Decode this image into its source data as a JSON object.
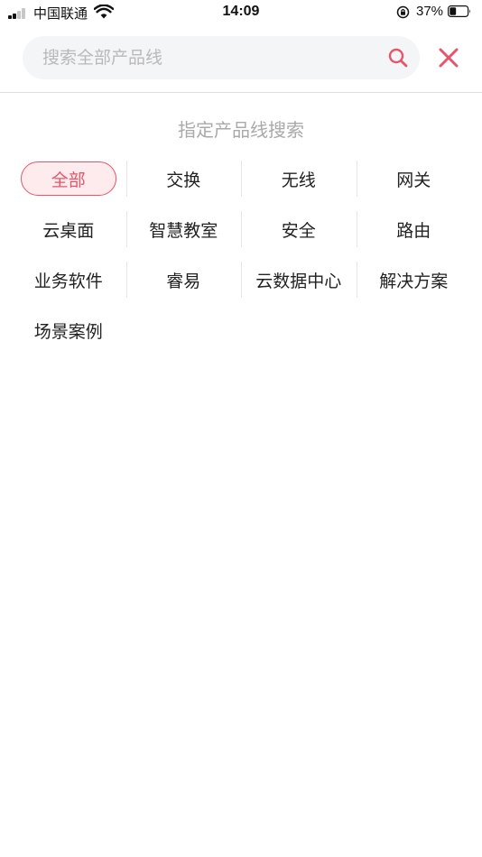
{
  "status_bar": {
    "carrier": "中国联通",
    "time": "14:09",
    "battery_percent": "37%",
    "battery_level": 0.37,
    "icons": [
      "signal-icon",
      "wifi-icon",
      "rotation-lock-icon",
      "battery-icon"
    ]
  },
  "search": {
    "value": "",
    "placeholder": "搜索全部产品线",
    "search_icon": "search-icon",
    "close_icon": "close-icon"
  },
  "section": {
    "title": "指定产品线搜索",
    "selected_index": 0,
    "items": [
      "全部",
      "交换",
      "无线",
      "网关",
      "云桌面",
      "智慧教室",
      "安全",
      "路由",
      "业务软件",
      "睿易",
      "云数据中心",
      "解决方案",
      "场景案例"
    ]
  },
  "colors": {
    "accent": "#e5566b",
    "accent_bg": "#fdebed",
    "placeholder": "#b9b9b9",
    "section_title": "#a9a9a9",
    "search_bg": "#f4f5f7",
    "divider": "#e6e6e6"
  }
}
